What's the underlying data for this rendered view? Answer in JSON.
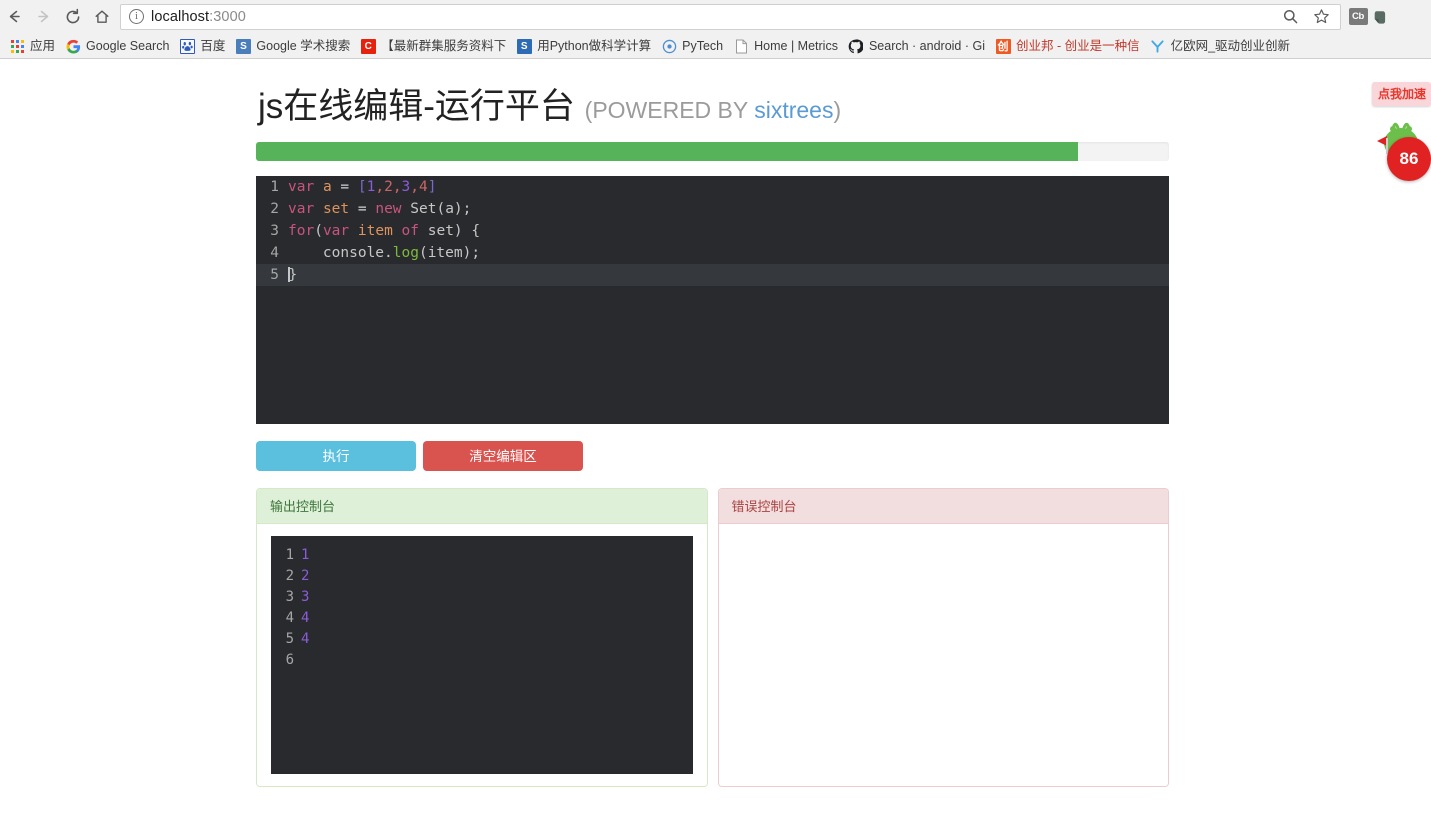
{
  "browser": {
    "nav": {
      "back_label": "Back",
      "forward_label": "Forward",
      "reload_label": "Reload",
      "home_label": "Home"
    },
    "omnibox": {
      "url_host": "localhost",
      "url_port": ":3000",
      "info_glyph": "i",
      "search_label": "Search",
      "bookmark_label": "Bookmark this page"
    },
    "extensions": [
      {
        "name": "cb-extension",
        "label": "Cb"
      },
      {
        "name": "evernote-extension",
        "label": ""
      }
    ],
    "bookmarks": [
      {
        "label": "应用",
        "icon": "apps-grid-icon"
      },
      {
        "label": "Google Search",
        "icon": "google-icon"
      },
      {
        "label": "百度",
        "icon": "baidu-icon"
      },
      {
        "label": "Google 学术搜索",
        "icon": "google-scholar-icon"
      },
      {
        "label": "【最新群集服务资料下",
        "icon": "c-icon"
      },
      {
        "label": "用Python做科学计算",
        "icon": "s-icon"
      },
      {
        "label": "PyTech",
        "icon": "pytech-icon"
      },
      {
        "label": "Home | Metrics",
        "icon": "page-icon"
      },
      {
        "label": "Search · android · Gi",
        "icon": "github-icon"
      },
      {
        "label": "创业邦 - 创业是一种信",
        "icon": "chuangyebang-icon"
      },
      {
        "label": "亿欧网_驱动创业创新",
        "icon": "iyiou-icon"
      }
    ],
    "floating": {
      "bubble_text": "点我加速",
      "badge_count": "86"
    }
  },
  "page": {
    "title_main": "js在线编辑-运行平台",
    "title_sub_prefix": "(POWERED BY ",
    "title_sub_link": "sixtrees",
    "title_sub_suffix": ")",
    "progress": {
      "percent": 90,
      "fill_color": "#57b35a",
      "track_color": "#f3f3f3"
    },
    "editor": {
      "active_line": 5,
      "lines": [
        {
          "n": "1",
          "tokens": [
            {
              "t": "var",
              "c": "kw"
            },
            {
              "t": " ",
              "c": "plain"
            },
            {
              "t": "a",
              "c": "var"
            },
            {
              "t": " ",
              "c": "plain"
            },
            {
              "t": "=",
              "c": "op"
            },
            {
              "t": " ",
              "c": "plain"
            },
            {
              "t": "[",
              "c": "punct"
            },
            {
              "t": "1",
              "c": "num"
            },
            {
              "t": ",",
              "c": "num2"
            },
            {
              "t": "2",
              "c": "num2"
            },
            {
              "t": ",",
              "c": "num2"
            },
            {
              "t": "3",
              "c": "num"
            },
            {
              "t": ",",
              "c": "num2"
            },
            {
              "t": "4",
              "c": "num2"
            },
            {
              "t": "]",
              "c": "punct"
            }
          ]
        },
        {
          "n": "2",
          "tokens": [
            {
              "t": "var",
              "c": "kw"
            },
            {
              "t": " ",
              "c": "plain"
            },
            {
              "t": "set",
              "c": "var"
            },
            {
              "t": " ",
              "c": "plain"
            },
            {
              "t": "=",
              "c": "op"
            },
            {
              "t": " ",
              "c": "plain"
            },
            {
              "t": "new",
              "c": "kw"
            },
            {
              "t": " ",
              "c": "plain"
            },
            {
              "t": "Set(a);",
              "c": "plain"
            }
          ]
        },
        {
          "n": "3",
          "tokens": [
            {
              "t": "for",
              "c": "kw"
            },
            {
              "t": "(",
              "c": "plain"
            },
            {
              "t": "var",
              "c": "kw"
            },
            {
              "t": " ",
              "c": "plain"
            },
            {
              "t": "item",
              "c": "var"
            },
            {
              "t": " ",
              "c": "plain"
            },
            {
              "t": "of",
              "c": "kw"
            },
            {
              "t": " ",
              "c": "plain"
            },
            {
              "t": "set) {",
              "c": "plain"
            }
          ]
        },
        {
          "n": "4",
          "tokens": [
            {
              "t": "    console.",
              "c": "plain"
            },
            {
              "t": "log",
              "c": "fn"
            },
            {
              "t": "(item);",
              "c": "plain"
            }
          ]
        },
        {
          "n": "5",
          "tokens": [
            {
              "t": "}",
              "c": "plain"
            }
          ]
        }
      ]
    },
    "buttons": {
      "run_label": "执行",
      "run_color": "#5bc0de",
      "clear_label": "清空编辑区",
      "clear_color": "#d9534f"
    },
    "output_panel": {
      "heading": "输出控制台",
      "head_bg": "#dff0d8",
      "head_color": "#3c763d",
      "lines": [
        {
          "n": "1",
          "value": "1"
        },
        {
          "n": "2",
          "value": "2"
        },
        {
          "n": "3",
          "value": "3"
        },
        {
          "n": "4",
          "value": "4"
        },
        {
          "n": "5",
          "value": "4"
        },
        {
          "n": "6",
          "value": ""
        }
      ]
    },
    "error_panel": {
      "heading": "错误控制台",
      "head_bg": "#f2dede",
      "head_color": "#a94442",
      "lines": []
    }
  }
}
